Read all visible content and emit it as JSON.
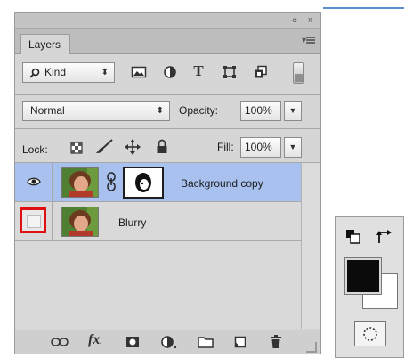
{
  "panel": {
    "title_controls": {
      "collapse": "«",
      "close": "×"
    },
    "tab_label": "Layers",
    "filter": {
      "kind_label": "Kind"
    },
    "blend_mode": "Normal",
    "opacity_label": "Opacity:",
    "opacity_value": "100%",
    "lock_label": "Lock:",
    "fill_label": "Fill:",
    "fill_value": "100%",
    "layers": [
      {
        "name": "Background copy",
        "selected": true,
        "visible": true,
        "has_mask": true
      },
      {
        "name": "Blurry",
        "selected": false,
        "visible": false,
        "has_mask": false
      }
    ],
    "bottom_icons": [
      "link-layers-icon",
      "fx-icon",
      "add-mask-icon",
      "adjustment-layer-icon",
      "group-folder-icon",
      "new-layer-icon",
      "trash-icon"
    ]
  },
  "tools": {
    "foreground_color": "#0b0b0b",
    "background_color": "#ffffff"
  },
  "colors": {
    "selection": "#a8c1ef",
    "highlight_red": "#e01010"
  }
}
